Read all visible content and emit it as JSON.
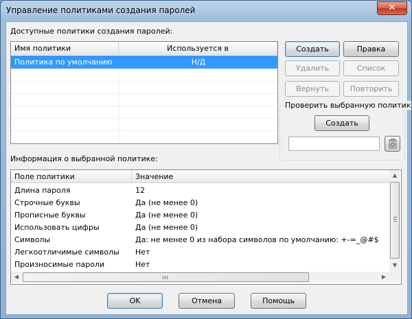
{
  "window": {
    "title": "Управление политиками создания паролей",
    "close_glyph": "✕"
  },
  "available": {
    "label": "Доступные политики создания паролей:",
    "columns": [
      "Имя политики",
      "Используется в"
    ],
    "rows": [
      {
        "name": "Политика по умолчанию",
        "used_in": "Н/Д",
        "selected": true
      }
    ]
  },
  "buttons": {
    "create": "Создать",
    "edit": "Правка",
    "delete": "Удалить",
    "list": "Список",
    "undo": "Вернуть",
    "redo": "Повторить"
  },
  "check": {
    "title": "Проверить выбранную политику",
    "create": "Создать",
    "value": "",
    "copy_icon": "copy-clipboard-icon"
  },
  "info": {
    "label": "Информация о выбранной политике:",
    "columns": [
      "Поле политики",
      "Значение"
    ],
    "rows": [
      {
        "field": "Длина пароля",
        "value": "12"
      },
      {
        "field": "Строчные буквы",
        "value": "Да (не менее 0)"
      },
      {
        "field": "Прописные буквы",
        "value": "Да (не менее 0)"
      },
      {
        "field": "Использовать цифры",
        "value": "Да (не менее 0)"
      },
      {
        "field": "Символы",
        "value": "Да: не менее 0 из набора символов по умолчанию: +-=_@#$"
      },
      {
        "field": "Легкоотличимые символы",
        "value": "Нет"
      },
      {
        "field": "Произносимые пароли",
        "value": "Нет"
      }
    ]
  },
  "footer": {
    "ok": "OK",
    "cancel": "Отмена",
    "help": "Помощь"
  },
  "colors": {
    "selection": "#3399ff",
    "title_gradient": "#a9c6e2",
    "close_red": "#c0391f"
  }
}
